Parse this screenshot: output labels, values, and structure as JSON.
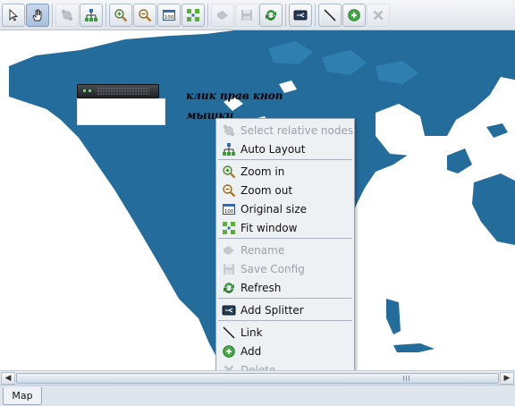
{
  "toolbar": {
    "buttons": [
      {
        "name": "select",
        "icon": "arrow-pointer-icon",
        "state": "normal"
      },
      {
        "name": "pan",
        "icon": "hand-icon",
        "state": "pressed"
      },
      {
        "name": "select-relative-nodes",
        "icon": "relative-nodes-icon",
        "state": "disabled"
      },
      {
        "name": "auto-layout",
        "icon": "tree-layout-icon",
        "state": "normal"
      },
      {
        "name": "zoom-in",
        "icon": "zoom-in-icon",
        "state": "normal"
      },
      {
        "name": "zoom-out",
        "icon": "zoom-out-icon",
        "state": "normal"
      },
      {
        "name": "original-size",
        "icon": "original-size-icon",
        "state": "normal"
      },
      {
        "name": "fit-window",
        "icon": "fit-window-icon",
        "state": "normal"
      },
      {
        "name": "rename",
        "icon": "rename-icon",
        "state": "disabled"
      },
      {
        "name": "save-config",
        "icon": "save-icon",
        "state": "disabled"
      },
      {
        "name": "refresh",
        "icon": "refresh-icon",
        "state": "normal"
      },
      {
        "name": "add-splitter",
        "icon": "splitter-icon",
        "state": "normal"
      },
      {
        "name": "link",
        "icon": "link-line-icon",
        "state": "normal"
      },
      {
        "name": "add",
        "icon": "add-icon",
        "state": "normal"
      },
      {
        "name": "delete",
        "icon": "delete-icon",
        "state": "disabled"
      }
    ]
  },
  "map": {
    "ocean_color": "#236c9c",
    "land_color": "#ffffff",
    "annotation": "клик прав кноп мышки"
  },
  "menu": {
    "items": [
      {
        "label": "Select relative nodes",
        "icon": "relative-nodes-icon",
        "enabled": false
      },
      {
        "label": "Auto Layout",
        "icon": "tree-layout-icon",
        "enabled": true
      },
      {
        "label": "Zoom in",
        "icon": "zoom-in-icon",
        "enabled": true
      },
      {
        "label": "Zoom out",
        "icon": "zoom-out-icon",
        "enabled": true
      },
      {
        "label": "Original size",
        "icon": "original-size-icon",
        "enabled": true
      },
      {
        "label": "Fit window",
        "icon": "fit-window-icon",
        "enabled": true
      },
      {
        "label": "Rename",
        "icon": "rename-icon",
        "enabled": false
      },
      {
        "label": "Save Config",
        "icon": "save-icon",
        "enabled": false
      },
      {
        "label": "Refresh",
        "icon": "refresh-icon",
        "enabled": true
      },
      {
        "label": "Add Splitter",
        "icon": "splitter-icon",
        "enabled": true
      },
      {
        "label": "Link",
        "icon": "link-line-icon",
        "enabled": true
      },
      {
        "label": "Add",
        "icon": "add-icon",
        "enabled": true
      },
      {
        "label": "Delete",
        "icon": "delete-icon",
        "enabled": false
      }
    ]
  },
  "tabs": [
    {
      "label": "Map",
      "active": true
    }
  ]
}
